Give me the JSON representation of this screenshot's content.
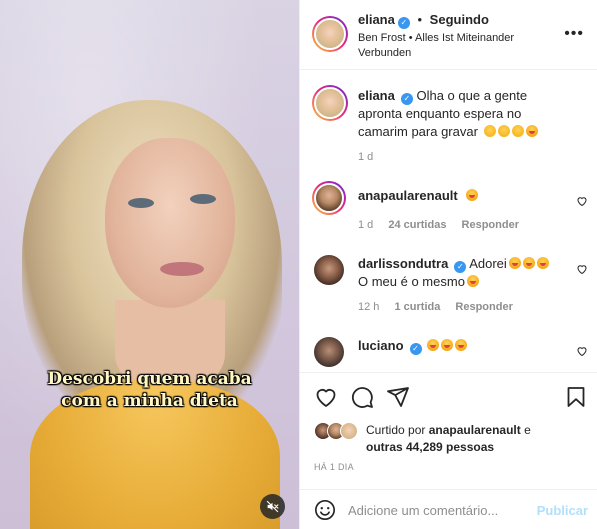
{
  "post": {
    "caption_lines": [
      "Descobri quem acaba",
      "com a minha dieta"
    ]
  },
  "header": {
    "username": "eliana",
    "separator": "•",
    "follow_label": "Seguindo",
    "audio": "Ben Frost • Alles Ist Miteinander Verbunden",
    "more_label": "•••"
  },
  "caption_comment": {
    "username": "eliana",
    "text": "Olha o que a gente apronta enquanto espera no camarim para gravar",
    "time": "1 d"
  },
  "comments": [
    {
      "username": "anapaularenault",
      "text": "",
      "time": "1 d",
      "likes": "24 curtidas",
      "reply_label": "Responder"
    },
    {
      "username": "darlissondutra",
      "text": "Adorei",
      "text2": "O meu é o mesmo",
      "time": "12 h",
      "likes": "1 curtida",
      "reply_label": "Responder"
    },
    {
      "username": "luciano",
      "text": ""
    }
  ],
  "likes": {
    "prefix": "Curtido por",
    "user": "anapaularenault",
    "middle": "e",
    "others": "outras 44,289 pessoas"
  },
  "time_ago": "HÁ 1 DIA",
  "composer": {
    "placeholder": "Adicione um comentário...",
    "post_label": "Publicar"
  },
  "icons": [
    "muted-audio-icon",
    "verified-icon",
    "heart-icon",
    "comment-icon",
    "share-icon",
    "bookmark-icon",
    "emoji-icon",
    "more-options-icon"
  ],
  "colors": {
    "verified": "#3897f0",
    "publish_disabled": "#b2dffc",
    "muted_text": "#8e8e8e"
  }
}
